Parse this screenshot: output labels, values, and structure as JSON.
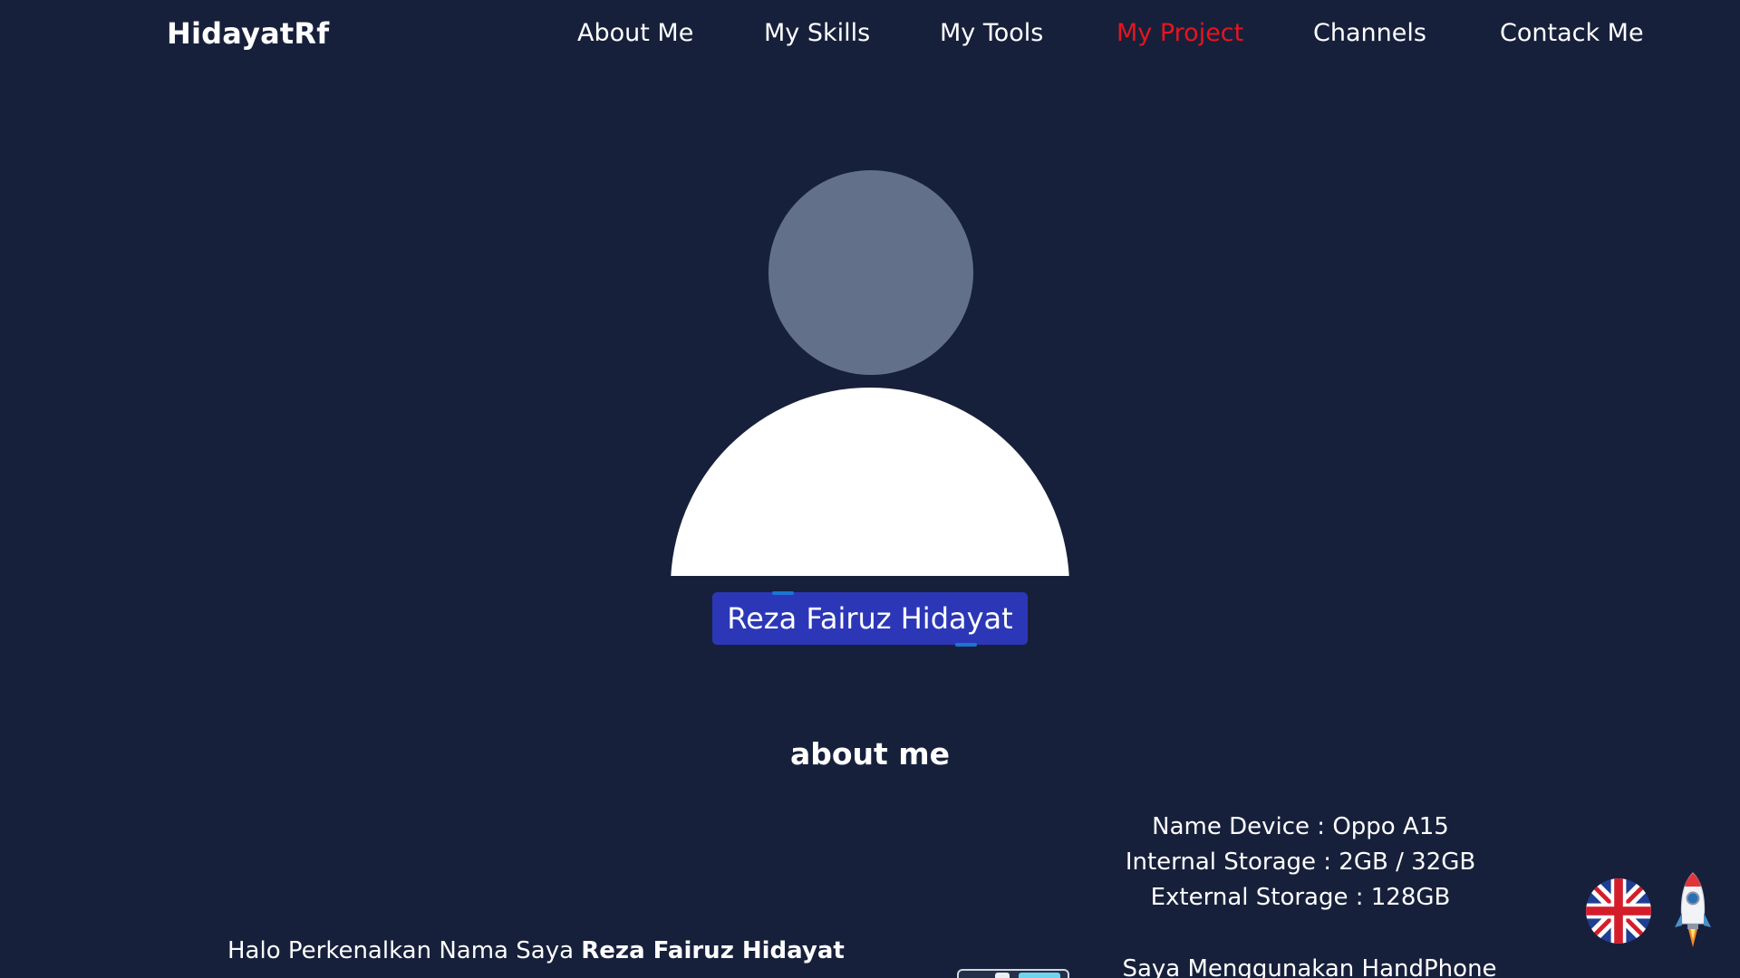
{
  "navbar": {
    "brand": "HidayatRf",
    "links": [
      {
        "label": "About Me"
      },
      {
        "label": "My Skills"
      },
      {
        "label": "My Tools"
      },
      {
        "label": "My Project"
      },
      {
        "label": "Channels"
      },
      {
        "label": "Contack Me"
      }
    ],
    "active_color": "#e6151e"
  },
  "profile": {
    "name": "Reza Fairuz Hidayat"
  },
  "about": {
    "title": "about me",
    "intro_prefix": "Halo Perkenalkan Nama Saya",
    "intro_name": "Reza Fairuz Hidayat",
    "device_specs": [
      "Name Device : Oppo A15",
      "Internal Storage : 2GB / 32GB",
      "External Storage : 128GB"
    ],
    "device_caption": "Saya Menggunakan HandPhone"
  },
  "floating": {
    "language_icon": "uk-flag-icon",
    "scroll_top_icon": "rocket-icon"
  },
  "colors": {
    "background": "#17203b",
    "badge": "#2c37b8",
    "avatar_head": "#627189"
  }
}
